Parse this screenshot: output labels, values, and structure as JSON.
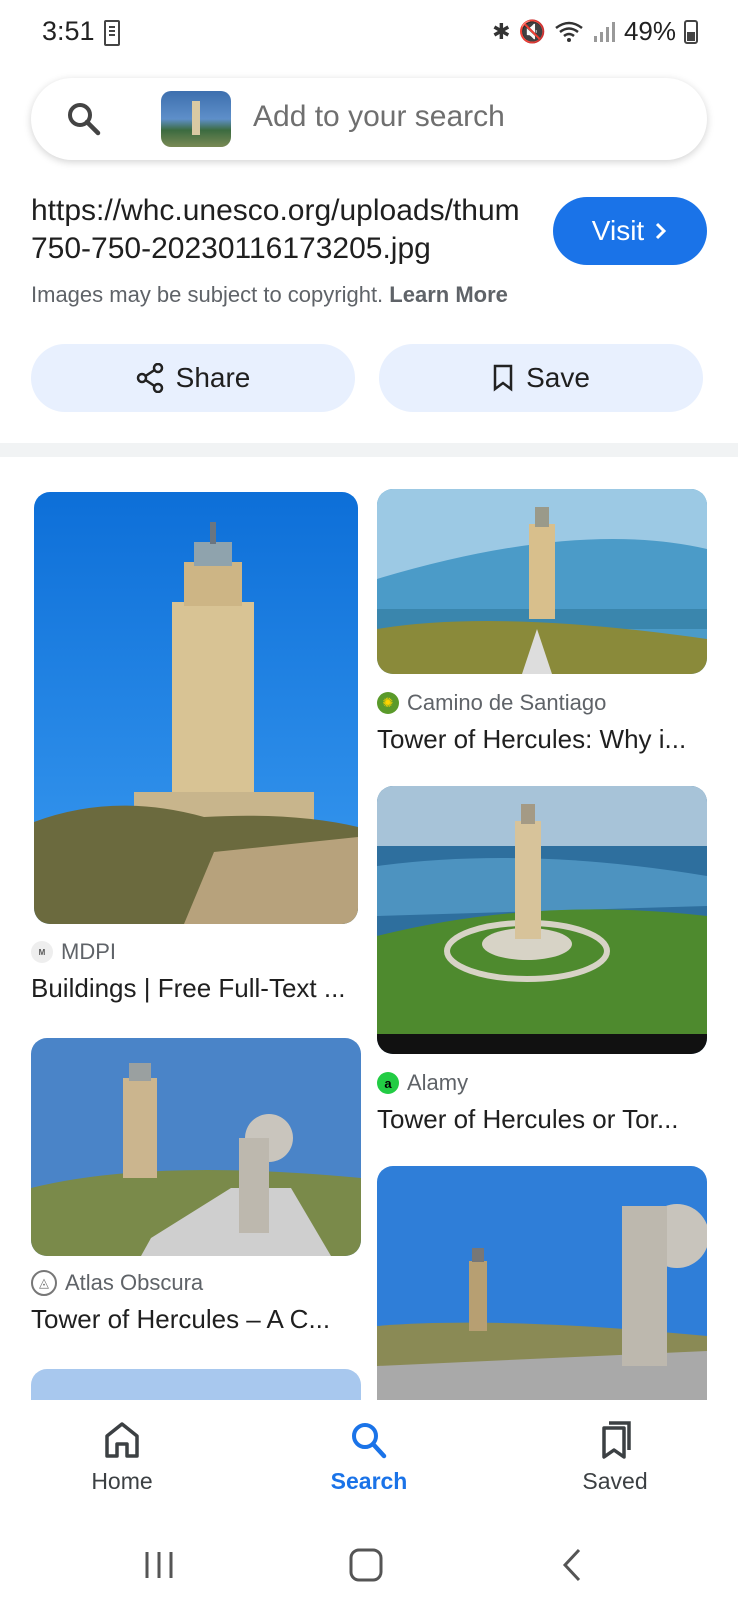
{
  "status": {
    "time": "3:51",
    "battery": "49%"
  },
  "search": {
    "placeholder": "Add to your search"
  },
  "source": {
    "url_line1": "https://whc.unesco.org/uploads/thumbs/",
    "url_line2": "750-750-20230116173205.jpg",
    "visit_label": "Visit",
    "copyright": "Images may be subject to copyright.",
    "learn_more": "Learn More"
  },
  "actions": {
    "share": "Share",
    "save": "Save"
  },
  "results": [
    {
      "site": "MDPI",
      "title": "Buildings | Free Full-Text ..."
    },
    {
      "site": "Camino de Santiago",
      "title": "Tower of Hercules: Why i..."
    },
    {
      "site": "Alamy",
      "title": "Tower of Hercules or Tor..."
    },
    {
      "site": "Atlas Obscura",
      "title": "Tower of Hercules – A C..."
    }
  ],
  "nav": {
    "home": "Home",
    "search": "Search",
    "saved": "Saved"
  },
  "colors": {
    "accent": "#1a73e8",
    "pill_bg": "#e8f0fe"
  }
}
